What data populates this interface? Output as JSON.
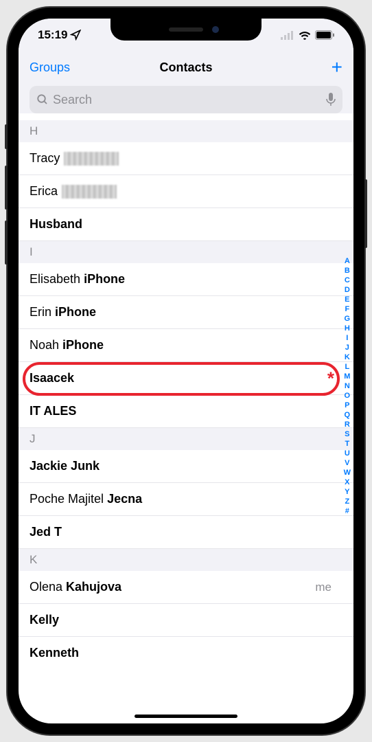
{
  "status": {
    "time": "15:19"
  },
  "nav": {
    "left": "Groups",
    "title": "Contacts",
    "add": "+"
  },
  "search": {
    "placeholder": "Search"
  },
  "sections": [
    {
      "letter": "H",
      "contacts": [
        {
          "first": "Tracy",
          "last": "",
          "blurred": true
        },
        {
          "first": "Erica",
          "last": "",
          "blurred": true
        },
        {
          "first": "",
          "last": "Husband",
          "bold": true
        }
      ]
    },
    {
      "letter": "I",
      "contacts": [
        {
          "first": "Elisabeth",
          "last": "iPhone"
        },
        {
          "first": "Erin",
          "last": "iPhone"
        },
        {
          "first": "Noah",
          "last": "iPhone"
        },
        {
          "first": "",
          "last": "Isaacek",
          "bold": true,
          "highlighted": true
        },
        {
          "first": "",
          "last": "IT ALES",
          "bold": true
        }
      ]
    },
    {
      "letter": "J",
      "contacts": [
        {
          "first": "Jackie",
          "last": "Junk",
          "boldAll": true
        },
        {
          "first": "Poche Majitel",
          "last": "Jecna"
        },
        {
          "first": "",
          "last": "Jed T",
          "bold": true
        }
      ]
    },
    {
      "letter": "K",
      "contacts": [
        {
          "first": "Olena",
          "last": "Kahujova",
          "me": true
        },
        {
          "first": "",
          "last": "Kelly",
          "bold": true
        },
        {
          "first": "",
          "last": "Kenneth",
          "bold": true
        }
      ]
    }
  ],
  "meLabel": "me",
  "index": [
    "A",
    "B",
    "C",
    "D",
    "E",
    "F",
    "G",
    "H",
    "I",
    "J",
    "K",
    "L",
    "M",
    "N",
    "O",
    "P",
    "Q",
    "R",
    "S",
    "T",
    "U",
    "V",
    "W",
    "X",
    "Y",
    "Z",
    "#"
  ]
}
